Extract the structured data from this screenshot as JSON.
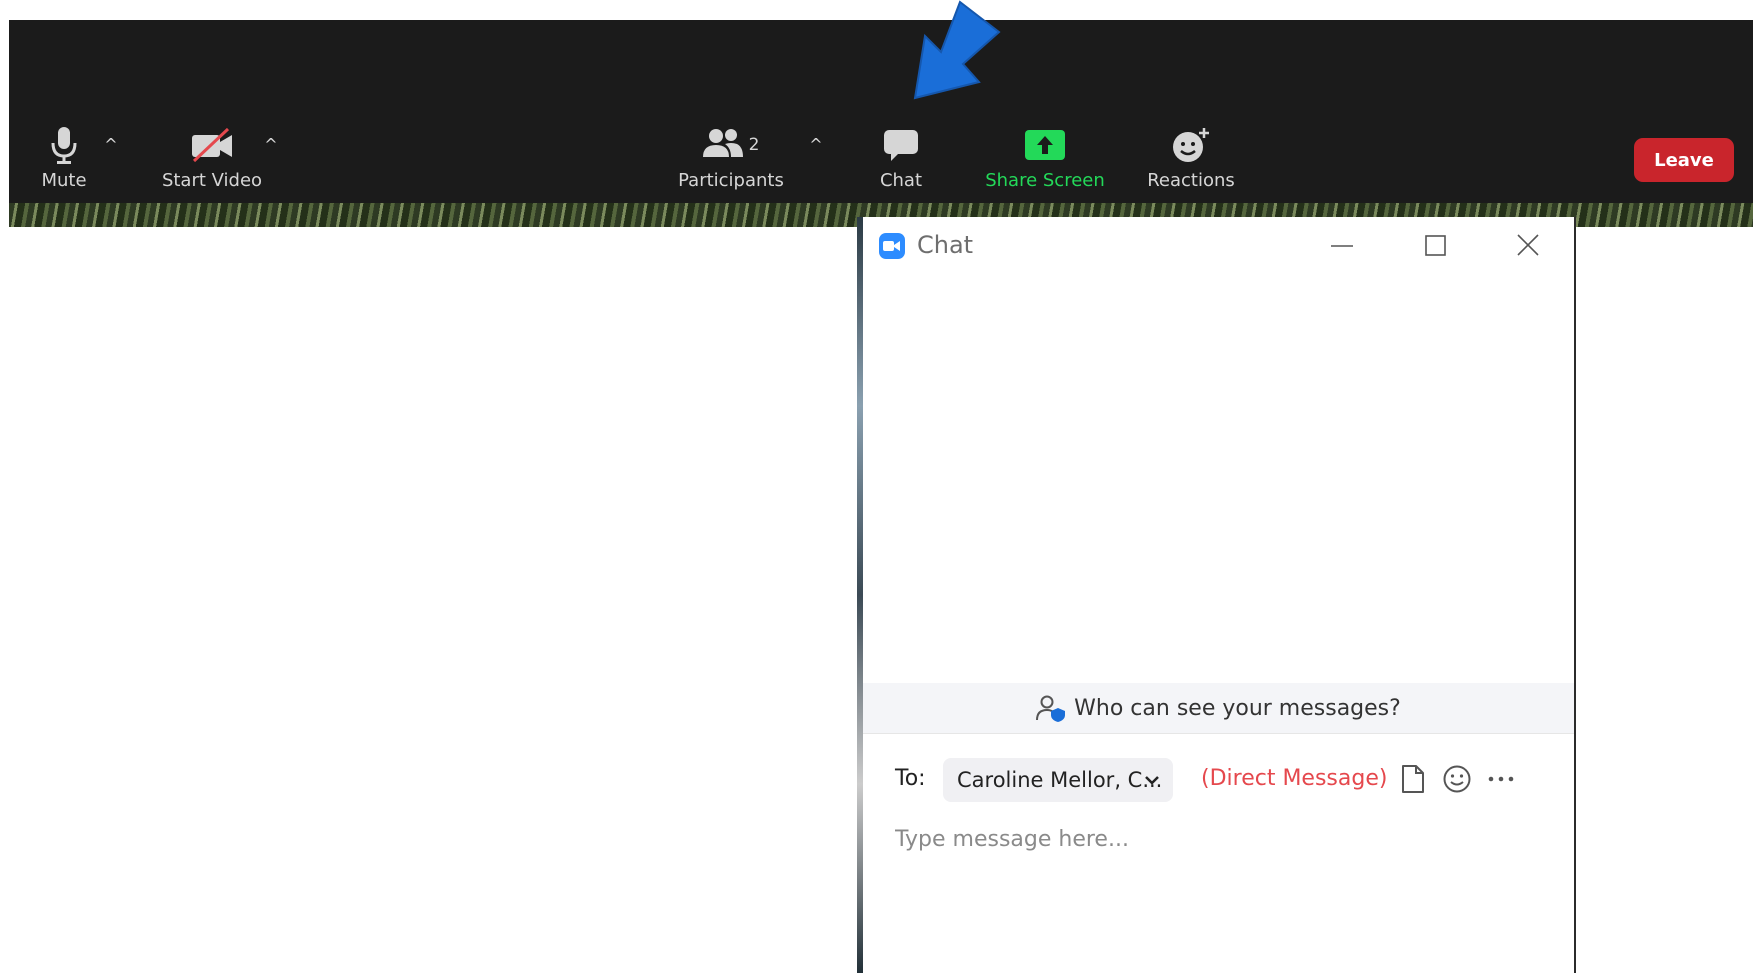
{
  "toolbar": {
    "mute_label": "Mute",
    "video_label": "Start Video",
    "participants_label": "Participants",
    "participants_count": "2",
    "chat_label": "Chat",
    "share_label": "Share Screen",
    "reactions_label": "Reactions",
    "leave_label": "Leave",
    "caret": "^",
    "colors": {
      "background": "#1b1b1b",
      "share": "#23d959",
      "leave": "#c9252c",
      "arrow": "#1a6ed8"
    }
  },
  "chat_window": {
    "title": "Chat",
    "who_can_see": "Who can see your messages?",
    "to_label": "To:",
    "recipient": "Caroline Mellor, C...",
    "direct_message": "(Direct Message)",
    "input_placeholder": "Type message here...",
    "icons": [
      "file-icon",
      "emoji-icon",
      "more-icon"
    ]
  }
}
